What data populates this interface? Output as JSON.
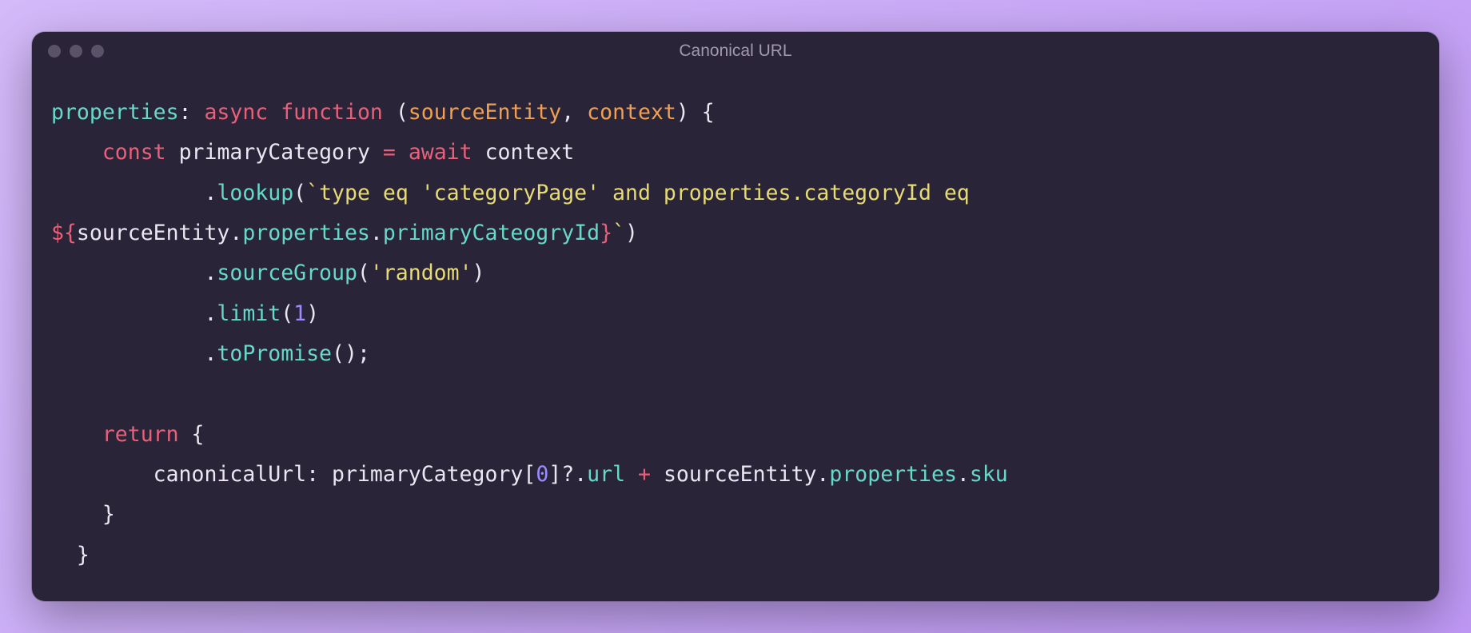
{
  "window": {
    "title": "Canonical URL"
  },
  "code": {
    "l1": {
      "prop": "properties",
      "colon": ": ",
      "async": "async",
      "sp1": " ",
      "func": "function",
      "sp2": " ",
      "lp": "(",
      "p1": "sourceEntity",
      "comma": ", ",
      "p2": "context",
      "rp": ")",
      "sp3": " ",
      "lb": "{"
    },
    "l2": {
      "indent": "    ",
      "const": "const",
      "sp1": " ",
      "name": "primaryCategory",
      "sp2": " ",
      "eq": "=",
      "sp3": " ",
      "await": "await",
      "sp4": " ",
      "ctx": "context"
    },
    "l3": {
      "indent": "            ",
      "dot": ".",
      "method": "lookup",
      "lp": "(",
      "bt": "`",
      "s1": "type eq 'categoryPage' and properties.categoryId eq "
    },
    "l4": {
      "open": "${",
      "v1": "sourceEntity",
      "d1": ".",
      "v2": "properties",
      "d2": ".",
      "v3": "primaryCateogryId",
      "close": "}",
      "bt": "`",
      "rp": ")"
    },
    "l5": {
      "indent": "            ",
      "dot": ".",
      "method": "sourceGroup",
      "lp": "(",
      "str": "'random'",
      "rp": ")"
    },
    "l6": {
      "indent": "            ",
      "dot": ".",
      "method": "limit",
      "lp": "(",
      "num": "1",
      "rp": ")"
    },
    "l7": {
      "indent": "            ",
      "dot": ".",
      "method": "toPromise",
      "lp": "(",
      "rp": ")",
      "semi": ";"
    },
    "l8": {
      "blank": ""
    },
    "l9": {
      "indent": "    ",
      "ret": "return",
      "sp": " ",
      "lb": "{"
    },
    "l10": {
      "indent": "        ",
      "label": "canonicalUrl",
      "colon": ": ",
      "v1": "primaryCategory",
      "lbr": "[",
      "idx": "0",
      "rbr": "]",
      "opt": "?.",
      "url": "url",
      "sp1": " ",
      "plus": "+",
      "sp2": " ",
      "v2": "sourceEntity",
      "d1": ".",
      "v3": "properties",
      "d2": ".",
      "v4": "sku"
    },
    "l11": {
      "indent": "    ",
      "rb": "}"
    },
    "l12": {
      "indent": "  ",
      "rb": "}"
    }
  }
}
